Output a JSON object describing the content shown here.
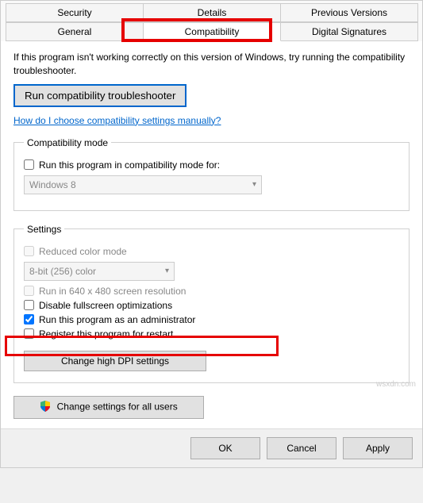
{
  "tabs_row1": {
    "security": "Security",
    "details": "Details",
    "previous": "Previous Versions"
  },
  "tabs_row2": {
    "general": "General",
    "compatibility": "Compatibility",
    "signatures": "Digital Signatures"
  },
  "desc": "If this program isn't working correctly on this version of Windows, try running the compatibility troubleshooter.",
  "run_troubleshooter": "Run compatibility troubleshooter",
  "manual_link": "How do I choose compatibility settings manually?",
  "compat_mode": {
    "legend": "Compatibility mode",
    "check_label": "Run this program in compatibility mode for:",
    "select_value": "Windows 8"
  },
  "settings": {
    "legend": "Settings",
    "reduced_color": "Reduced color mode",
    "color_select": "8-bit (256) color",
    "run_640": "Run in 640 x 480 screen resolution",
    "disable_fullscreen": "Disable fullscreen optimizations",
    "run_admin": "Run this program as an administrator",
    "register_restart": "Register this program for restart",
    "change_dpi": "Change high DPI settings"
  },
  "change_all_users": "Change settings for all users",
  "footer": {
    "ok": "OK",
    "cancel": "Cancel",
    "apply": "Apply"
  },
  "watermark": "wsxdn.com"
}
